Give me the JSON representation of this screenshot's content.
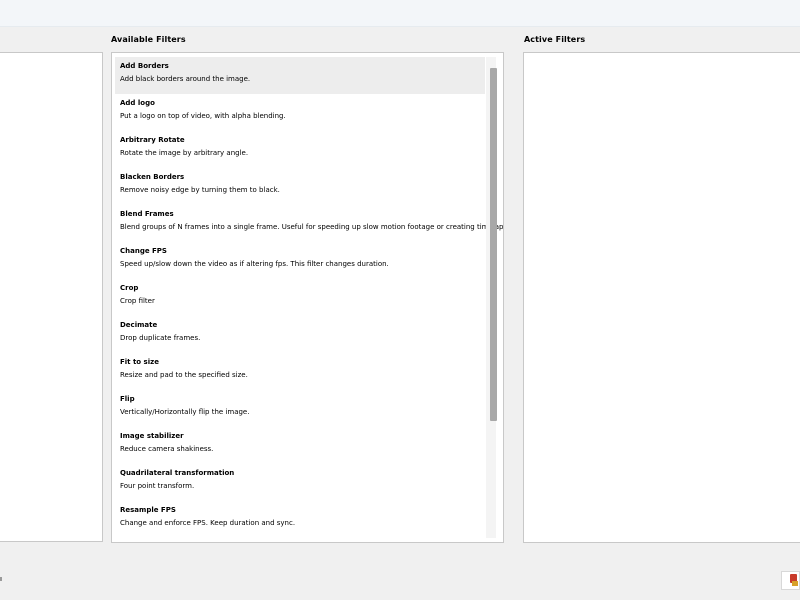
{
  "available_filters": {
    "title": "Available Filters",
    "items": [
      {
        "name": "Add Borders",
        "description": "Add black borders around the image."
      },
      {
        "name": "Add logo",
        "description": "Put a logo on top of video, with alpha blending."
      },
      {
        "name": "Arbitrary Rotate",
        "description": "Rotate the image by arbitrary angle."
      },
      {
        "name": "Blacken Borders",
        "description": "Remove noisy edge by turning them to black."
      },
      {
        "name": "Blend Frames",
        "description": "Blend groups of N frames into a single frame.  Useful for speeding up slow motion footage or creating timelapses."
      },
      {
        "name": "Change FPS",
        "description": "Speed up/slow down the video as if altering fps. This filter changes duration."
      },
      {
        "name": "Crop",
        "description": "Crop filter"
      },
      {
        "name": "Decimate",
        "description": "Drop duplicate frames."
      },
      {
        "name": "Fit to size",
        "description": "Resize and pad to the specified size."
      },
      {
        "name": "Flip",
        "description": "Vertically/Horizontally flip the image."
      },
      {
        "name": "Image stabilizer",
        "description": "Reduce camera shakiness."
      },
      {
        "name": "Quadrilateral transformation",
        "description": "Four point transform."
      },
      {
        "name": "Resample FPS",
        "description": "Change and enforce FPS. Keep duration and sync."
      }
    ],
    "selected_index": 0
  },
  "active_filters": {
    "title": "Active Filters"
  },
  "colors": {
    "selected_bg": "#ededed",
    "panel_bg": "#ffffff",
    "window_bg": "#f0f0f0"
  },
  "bottom_icon": "filter-icon"
}
